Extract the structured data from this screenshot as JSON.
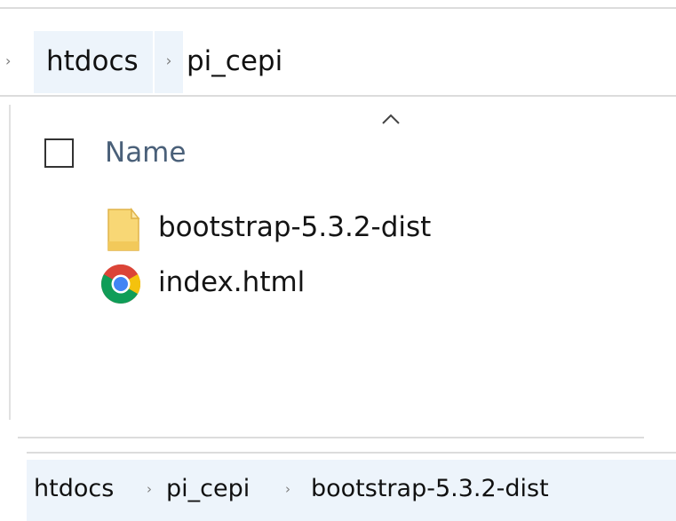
{
  "breadcrumb_top": {
    "lead_chevron": "›",
    "items": [
      "htdocs",
      "pi_cepi"
    ],
    "separator": "›"
  },
  "file_list": {
    "column_name": "Name",
    "items": [
      {
        "name": "bootstrap-5.3.2-dist",
        "icon": "folder-icon"
      },
      {
        "name": "index.html",
        "icon": "chrome-icon"
      }
    ]
  },
  "breadcrumb_bottom": {
    "items": [
      "htdocs",
      "pi_cepi",
      "bootstrap-5.3.2-dist"
    ],
    "separator": "›"
  },
  "colors": {
    "crumb_bg": "#edf4fb",
    "column_header_text": "#4a6079",
    "folder": "#f8d775",
    "chrome_red": "#db4437",
    "chrome_yellow": "#f4c20d",
    "chrome_green": "#0f9d58",
    "chrome_blue": "#4285f4"
  }
}
